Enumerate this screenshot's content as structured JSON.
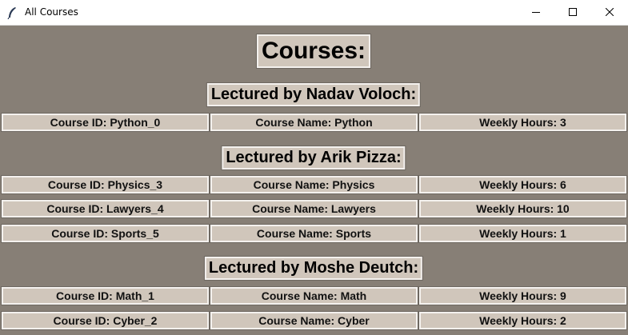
{
  "window": {
    "title": "All Courses"
  },
  "page": {
    "title": "Courses:"
  },
  "groups": [
    {
      "heading": "Lectured by Nadav Voloch:",
      "courses": [
        {
          "id": "Course ID: Python_0",
          "name": "Course Name: Python",
          "hours": "Weekly Hours: 3"
        }
      ]
    },
    {
      "heading": "Lectured by Arik Pizza:",
      "courses": [
        {
          "id": "Course ID: Physics_3",
          "name": "Course Name: Physics",
          "hours": "Weekly Hours: 6"
        },
        {
          "id": "Course ID: Lawyers_4",
          "name": "Course Name: Lawyers",
          "hours": "Weekly Hours: 10"
        },
        {
          "id": "Course ID: Sports_5",
          "name": "Course Name: Sports",
          "hours": "Weekly Hours: 1"
        }
      ]
    },
    {
      "heading": "Lectured by Moshe Deutch:",
      "courses": [
        {
          "id": "Course ID: Math_1",
          "name": "Course Name: Math",
          "hours": "Weekly Hours: 9"
        },
        {
          "id": "Course ID: Cyber_2",
          "name": "Course Name: Cyber",
          "hours": "Weekly Hours: 2"
        }
      ]
    }
  ],
  "colors": {
    "background": "#877f76",
    "cell": "#d0c6bb",
    "border_light": "#f4f1ee"
  },
  "icons": {
    "app": "feather-icon",
    "minimize": "minimize-icon",
    "maximize": "maximize-icon",
    "close": "close-icon"
  }
}
